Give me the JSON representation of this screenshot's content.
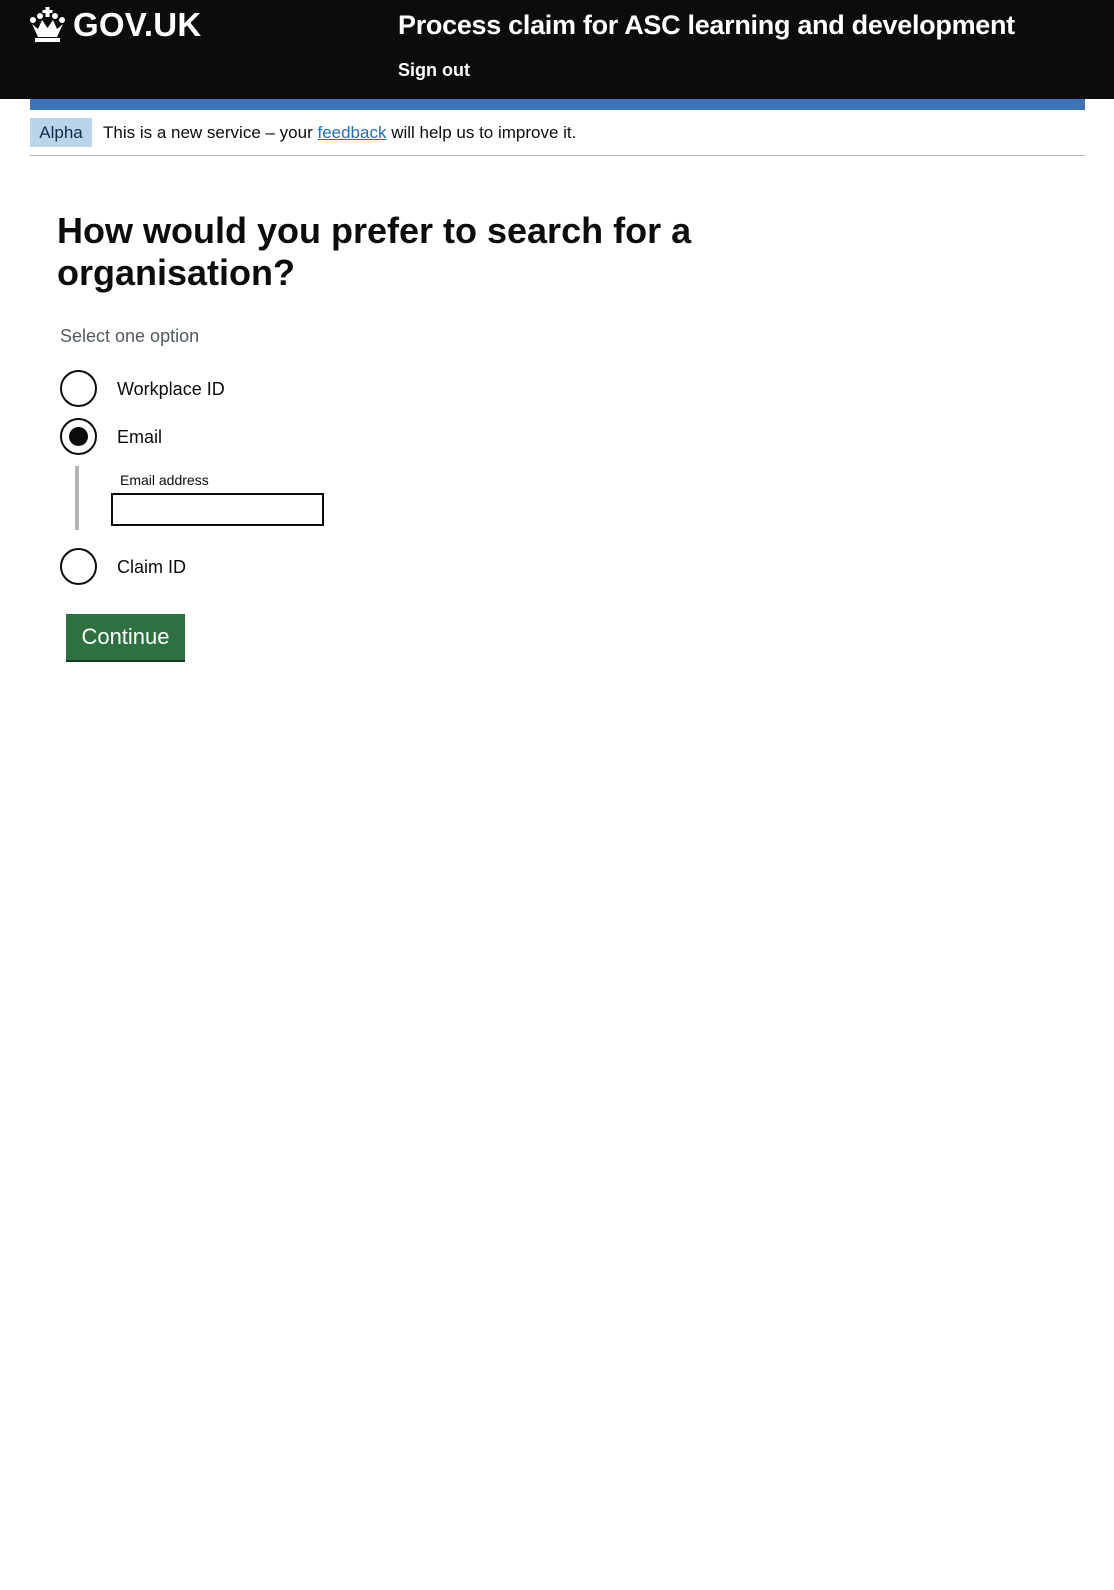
{
  "header": {
    "logo_text": "GOV.UK",
    "service_name": "Process claim for ASC learning and development",
    "sign_out_label": "Sign out"
  },
  "phase_banner": {
    "tag": "Alpha",
    "text_before": "This is a new service – your ",
    "link_text": "feedback",
    "text_after": " will help us to improve it."
  },
  "main": {
    "heading": "How would you prefer to search for a organisation?",
    "hint": "Select one option",
    "options": [
      {
        "label": "Workplace ID",
        "selected": false
      },
      {
        "label": "Email",
        "selected": true
      },
      {
        "label": "Claim ID",
        "selected": false
      }
    ],
    "email_field": {
      "label": "Email address",
      "value": ""
    },
    "continue_label": "Continue"
  },
  "colors": {
    "header_bg": "#0b0c0c",
    "blue_bar": "#3f73b8",
    "tag_bg": "#bbd4ea",
    "link": "#1d70b8",
    "button_bg": "#2e7040"
  },
  "icons": [
    "crown-icon"
  ]
}
